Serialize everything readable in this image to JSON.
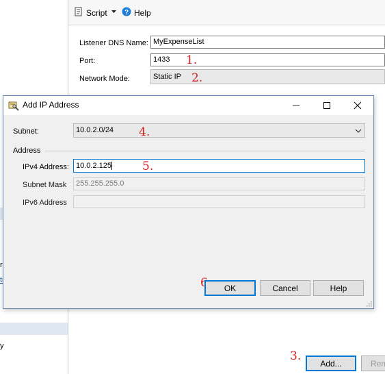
{
  "left_pane": {
    "frag_r": "r",
    "frag_tr": "tr",
    "frag_y": "y"
  },
  "toolbar": {
    "script_label": "Script",
    "help_label": "Help"
  },
  "listener": {
    "dns_label": "Listener DNS Name:",
    "dns_value": "MyExpenseList",
    "port_label": "Port:",
    "port_value": "1433",
    "mode_label": "Network Mode:",
    "mode_value": "Static IP"
  },
  "annotations": {
    "n1": "1.",
    "n2": "2.",
    "n3": "3.",
    "n4": "4.",
    "n5": "5.",
    "n6": "6."
  },
  "bottom_buttons": {
    "add_label": "Add...",
    "remove_label": "Rem"
  },
  "dialog": {
    "title": "Add IP Address",
    "subnet_label": "Subnet:",
    "subnet_value": "10.0.2.0/24",
    "address_group": "Address",
    "ipv4_label": "IPv4 Address:",
    "ipv4_value": "10.0.2.125",
    "mask_label": "Subnet Mask",
    "mask_value": "255.255.255.0",
    "ipv6_label": "IPv6 Address",
    "ipv6_value": "",
    "ok_label": "OK",
    "cancel_label": "Cancel",
    "help_label": "Help"
  },
  "icons": [
    "script-icon",
    "dropdown-arrow-icon",
    "help-icon",
    "dialog-app-icon",
    "minimize-icon",
    "maximize-icon",
    "close-icon",
    "chevron-down-icon",
    "resize-grip-icon"
  ],
  "colors": {
    "accent": "#0078d7",
    "annotation": "#d21f1f",
    "help_icon": "#1c7ed6"
  }
}
